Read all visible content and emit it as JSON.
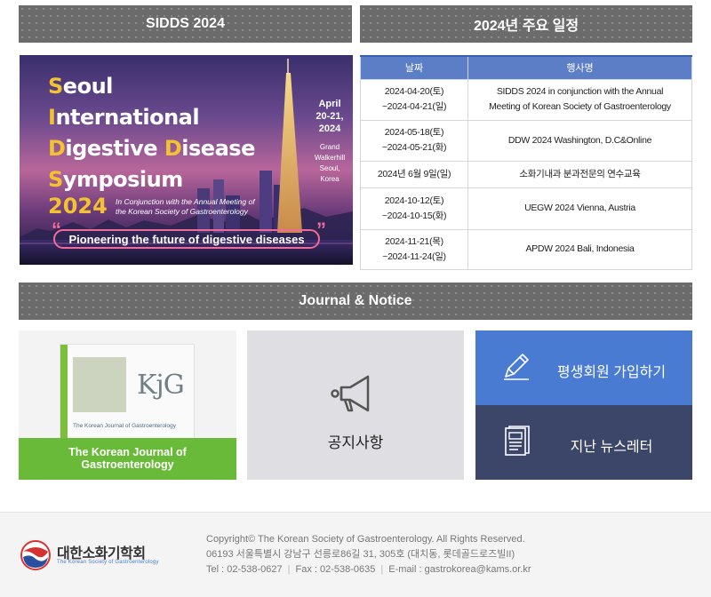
{
  "sections": {
    "sidds": "SIDDS 2024",
    "schedule": "2024년 주요 일정",
    "journal_notice": "Journal & Notice"
  },
  "banner": {
    "lines": [
      {
        "cap": "S",
        "rest": "eoul"
      },
      {
        "cap": "I",
        "rest": "nternational"
      },
      {
        "cap": "D",
        "rest": "igestive ",
        "cap2": "D",
        "rest2": "isease"
      },
      {
        "cap": "S",
        "rest": "ymposium"
      }
    ],
    "year": "2024",
    "conjunction_1": "In Conjunction with the Annual Meeting of",
    "conjunction_2": "the Korean Society of Gastroenterology",
    "slogan": "Pioneering the future of digestive diseases",
    "date_1": "April",
    "date_2": "20-21,",
    "date_3": "2024",
    "venue_1": "Grand",
    "venue_2": "Walkerhill",
    "venue_3": "Seoul,",
    "venue_4": "Korea"
  },
  "schedule_table": {
    "headers": [
      "날짜",
      "행사명"
    ],
    "rows": [
      {
        "date_1": "2024-04-20(토)",
        "date_2": "~2024-04-21(일)",
        "event_1": "SIDDS 2024 in conjunction with  the Annual",
        "event_2": "Meeting of  Korean Society of Gastroenterology"
      },
      {
        "date_1": "2024-05-18(토)",
        "date_2": "~2024-05-21(화)",
        "event_1": "DDW 2024  Washington, D.C&Online",
        "event_2": ""
      },
      {
        "date_1": "2024년 6월 9일(일)",
        "date_2": "",
        "event_1": "소화기내과 분과전문의 연수교육",
        "event_2": ""
      },
      {
        "date_1": "2024-10-12(토)",
        "date_2": "~2024-10-15(화)",
        "event_1": "UEGW 2024  Vienna, Austria",
        "event_2": ""
      },
      {
        "date_1": "2024-11-21(목)",
        "date_2": "~2024-11-24(일)",
        "event_1": "APDW 2024  Bali, Indonesia",
        "event_2": ""
      }
    ]
  },
  "journal": {
    "cover_title": "KjG",
    "cover_subtitle": "The Korean Journal of Gastroenterology",
    "label_1": "The Korean Journal of",
    "label_2": "Gastroenterology"
  },
  "notice": {
    "label": "공지사항",
    "icon": "megaphone-icon"
  },
  "member": {
    "label": "평생회원 가입하기",
    "icon": "pencil-icon"
  },
  "newsletter": {
    "label": "지난 뉴스레터",
    "icon": "document-icon"
  },
  "footer": {
    "org_name": "대한소화기학회",
    "org_name_en": "The Korean Society of Gastroenterology",
    "copyright": "Copyright© The Korean Society of Gastroenterology. All Rights Reserved.",
    "address": "06193 서울특별시 강남구 선릉로86길 31, 305호 (대치동, 롯데골드로즈빌II)",
    "tel": "Tel : 02-538-0627",
    "fax": "Fax : 02-538-0635",
    "email": "E-mail : gastrokorea@kams.or.kr"
  },
  "colors": {
    "accent_blue": "#4a7bd3",
    "navy": "#3c4668",
    "journal_green": "#6aba3a",
    "banner_yellow": "#f2c230"
  }
}
